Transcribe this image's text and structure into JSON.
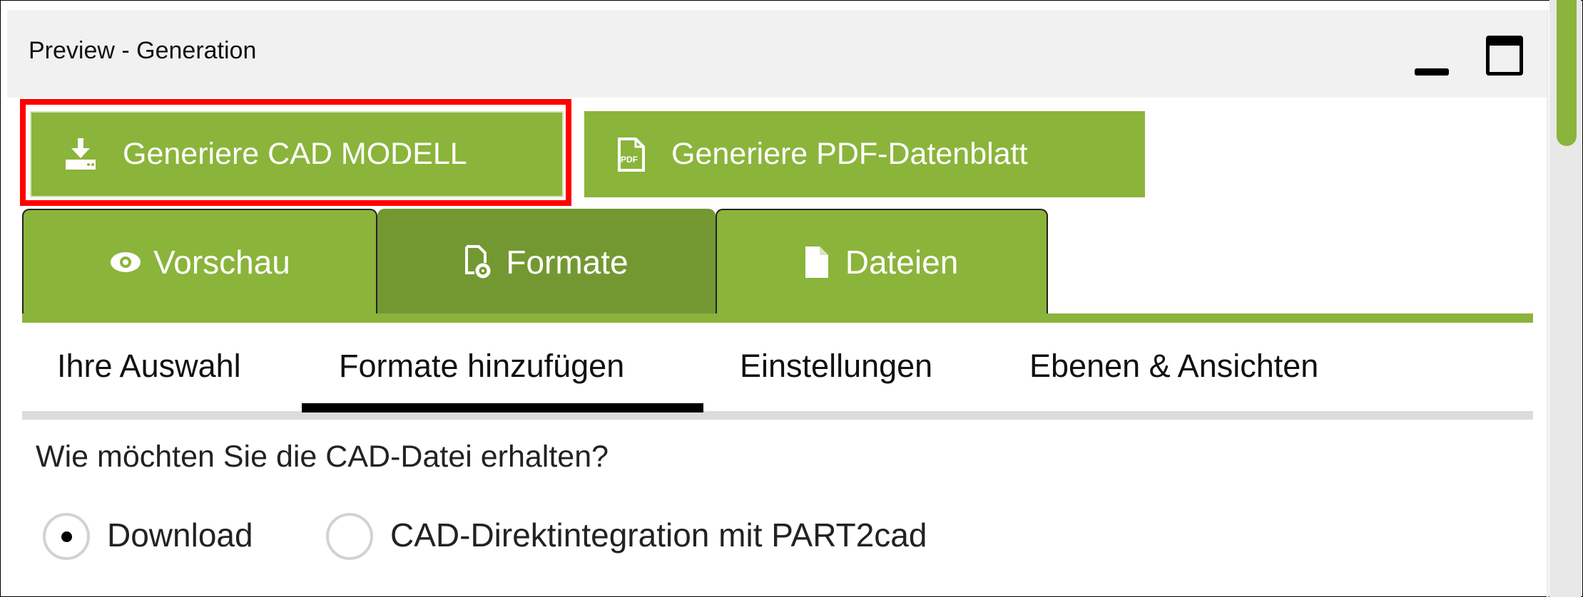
{
  "window": {
    "title": "Preview - Generation",
    "minimize_icon": "minimize-icon",
    "maximize_icon": "maximize-icon"
  },
  "actions": [
    {
      "label": "Generiere CAD MODELL",
      "icon": "download-icon",
      "highlighted": true
    },
    {
      "label": "Generiere PDF-Datenblatt",
      "icon": "pdf-file-icon"
    }
  ],
  "tabs": [
    {
      "label": "Vorschau",
      "icon": "eye-icon",
      "active": false
    },
    {
      "label": "Formate",
      "icon": "file-gear-icon",
      "active": true
    },
    {
      "label": "Dateien",
      "icon": "file-icon",
      "active": false
    }
  ],
  "subtabs": [
    {
      "label": "Ihre Auswahl"
    },
    {
      "label": "Formate hinzufügen",
      "active": true
    },
    {
      "label": "Einstellungen"
    },
    {
      "label": "Ebenen & Ansichten"
    }
  ],
  "delivery": {
    "question": "Wie möchten Sie die CAD-Datei erhalten?",
    "options": [
      {
        "label": "Download",
        "selected": true
      },
      {
        "label": "CAD-Direktintegration mit PART2cad",
        "selected": false
      }
    ]
  },
  "colors": {
    "accent": "#8bb43b",
    "accent_dark": "#739832",
    "highlight": "#ff0000"
  }
}
